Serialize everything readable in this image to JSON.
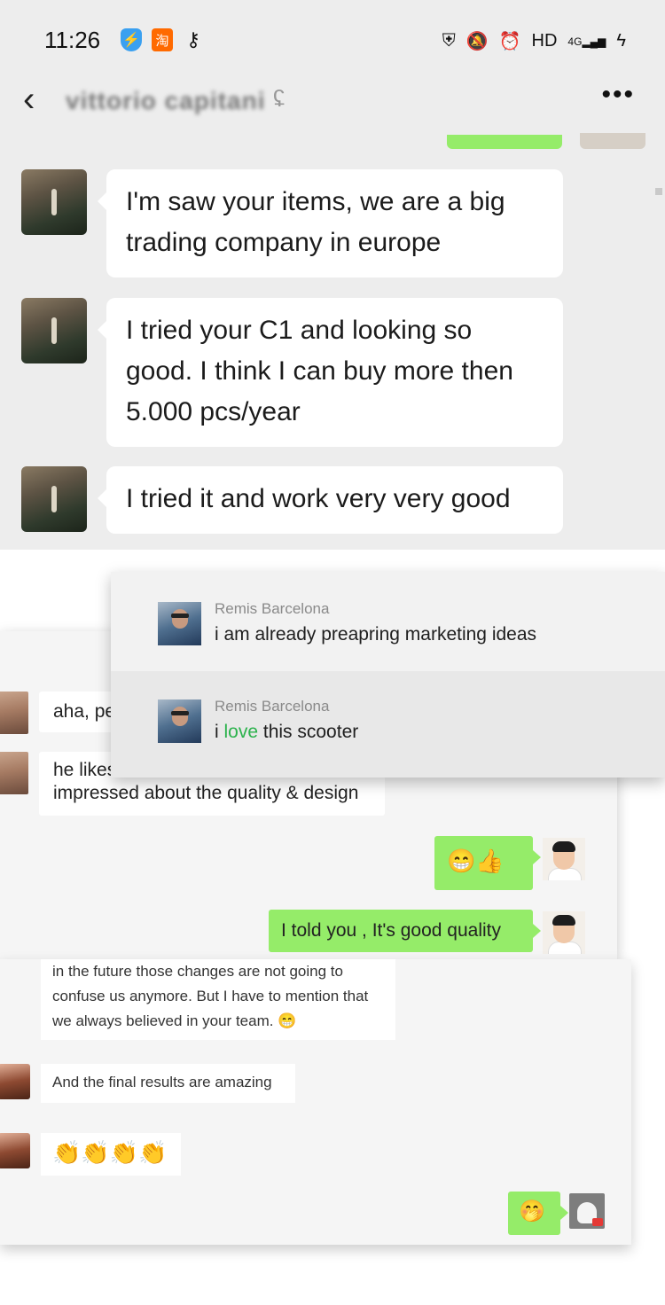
{
  "phone": {
    "status": {
      "time": "11:26",
      "left_icons": [
        "shield-icon",
        "taobao-icon",
        "key-icon"
      ],
      "taobao_glyph": "淘",
      "right_icons": [
        "vpn-icon",
        "mute-bell-icon",
        "alarm-icon",
        "hd-icon",
        "signal-4g-icon",
        "charging-icon"
      ],
      "hd_label": "HD",
      "net_label": "4G"
    },
    "header": {
      "title": "vittorio capitani",
      "back_glyph": "‹",
      "ear_glyph": "ʢ",
      "more_glyph": "•••"
    },
    "messages": [
      {
        "text": "I'm saw your items, we are a big trading company in europe"
      },
      {
        "text": "I tried your C1 and looking so good. I think I can buy more then 5.000 pcs/year"
      },
      {
        "text": "I tried it and work very very good"
      }
    ]
  },
  "desk1": {
    "messages": [
      {
        "text": "aha, pe"
      },
      {
        "text_line1": "he likes",
        "text_line2": "impressed about the quality & design"
      },
      {
        "emoji": "😁👍"
      },
      {
        "text": "I told you , It's good quality"
      }
    ]
  },
  "popup": {
    "items": [
      {
        "sender": "Remis Barcelona",
        "text": "i am already preapring marketing ideas"
      },
      {
        "sender": "Remis Barcelona",
        "text_before": "i ",
        "text_green": "love",
        "text_after": " this scooter"
      }
    ]
  },
  "desk2": {
    "messages": [
      {
        "line1": "in the future those changes are not going to",
        "line2": "confuse us anymore. But I have to mention that",
        "line3": "we always believed in your team.",
        "emoji": "😁"
      },
      {
        "text": "And the final results are amazing"
      },
      {
        "emoji": "👏👏👏👏"
      },
      {
        "emoji": "🤭"
      }
    ]
  },
  "colors": {
    "wechat_green": "#95ec69",
    "chat_background": "#ededed",
    "love_green": "#2bb24c"
  }
}
